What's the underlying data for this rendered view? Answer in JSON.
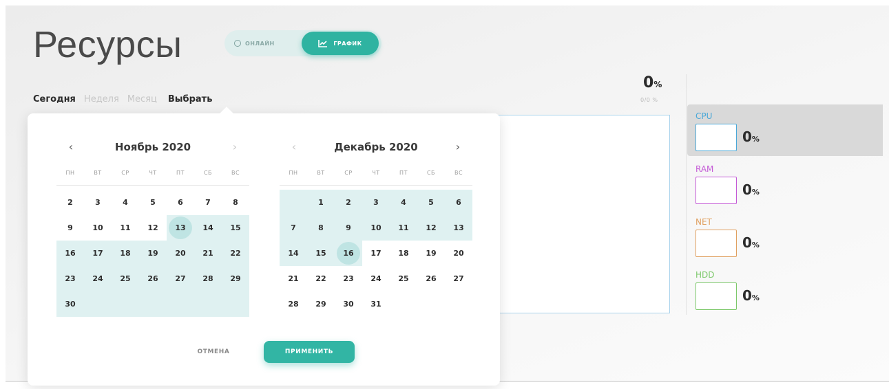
{
  "page": {
    "title": "Ресурсы"
  },
  "mode_toggle": {
    "online_label": "ОНЛАЙН",
    "graph_label": "ГРАФИК",
    "active": "graph"
  },
  "period_tabs": [
    {
      "label": "Сегодня",
      "active": true
    },
    {
      "label": "Неделя",
      "active": false
    },
    {
      "label": "Месяц",
      "active": false
    },
    {
      "label": "Выбрать",
      "active": true
    }
  ],
  "total": {
    "value": "0",
    "unit": "%",
    "sub": "0/0 %"
  },
  "metrics": [
    {
      "label": "CPU",
      "value": "0",
      "unit": "%",
      "color": "#4aa8d8",
      "selected": true
    },
    {
      "label": "RAM",
      "value": "0",
      "unit": "%",
      "color": "#c45ad6",
      "selected": false
    },
    {
      "label": "NET",
      "value": "0",
      "unit": "%",
      "color": "#e0a060",
      "selected": false
    },
    {
      "label": "HDD",
      "value": "0",
      "unit": "%",
      "color": "#7cc86a",
      "selected": false
    }
  ],
  "calendar": {
    "weekdays": [
      "ПН",
      "ВТ",
      "СР",
      "ЧТ",
      "ПТ",
      "СБ",
      "ВС"
    ],
    "months": [
      {
        "title": "Ноябрь 2020",
        "prev_enabled": true,
        "next_enabled": false,
        "lead_blanks": 0,
        "days": [
          2,
          3,
          4,
          5,
          6,
          7,
          8,
          9,
          10,
          11,
          12,
          13,
          14,
          15,
          16,
          17,
          18,
          19,
          20,
          21,
          22,
          23,
          24,
          25,
          26,
          27,
          28,
          29,
          30
        ],
        "range_from": 13,
        "range_to": 30,
        "endpoint": 13
      },
      {
        "title": "Декабрь 2020",
        "prev_enabled": false,
        "next_enabled": true,
        "lead_blanks": 1,
        "days": [
          1,
          2,
          3,
          4,
          5,
          6,
          7,
          8,
          9,
          10,
          11,
          12,
          13,
          14,
          15,
          16,
          17,
          18,
          19,
          20,
          21,
          22,
          23,
          24,
          25,
          26,
          27,
          28,
          29,
          30,
          31
        ],
        "range_from": 1,
        "range_to": 16,
        "endpoint": 16
      }
    ],
    "cancel_label": "ОТМЕНА",
    "apply_label": "ПРИМЕНИТЬ"
  },
  "colors": {
    "accent": "#32b5a4",
    "range": "#dff1f1",
    "endpoint": "#bfe4e3",
    "chart_border": "#a8d2ec"
  }
}
